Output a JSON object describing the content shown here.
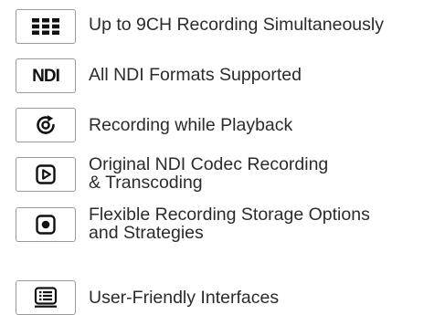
{
  "features": [
    {
      "icon": "grid-icon",
      "lines": [
        "Up to 9CH Recording Simultaneously"
      ]
    },
    {
      "icon": "ndi-logo-icon",
      "logo_text": "NDI",
      "lines": [
        "All NDI Formats Supported"
      ]
    },
    {
      "icon": "replay-icon",
      "lines": [
        "Recording while Playback"
      ]
    },
    {
      "icon": "play-icon",
      "lines": [
        "Original NDI Codec Recording",
        "& Transcoding"
      ]
    },
    {
      "icon": "record-icon",
      "lines": [
        "Flexible Recording Storage Options",
        "and Strategies"
      ]
    },
    {
      "icon": "list-icon",
      "lines": [
        "User-Friendly Interfaces"
      ]
    }
  ]
}
